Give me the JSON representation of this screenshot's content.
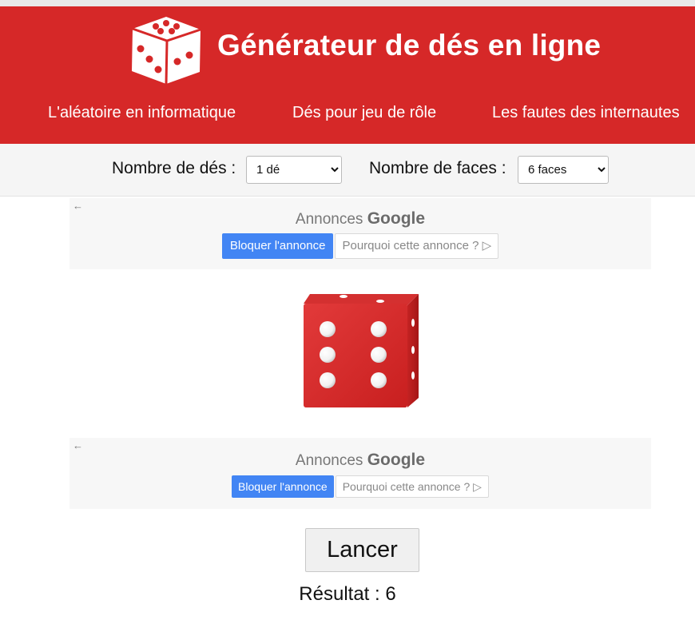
{
  "header": {
    "title": "Générateur de dés en ligne",
    "logo_icon": "dice-logo-icon",
    "background": "#d62828"
  },
  "nav": [
    {
      "label": "L'aléatoire en informatique"
    },
    {
      "label": "Dés pour jeu de rôle"
    },
    {
      "label": "Les fautes des internautes"
    }
  ],
  "options": {
    "dice_count_label": "Nombre de dés :",
    "dice_count_value": "1 dé",
    "faces_label": "Nombre de faces :",
    "faces_value": "6 faces"
  },
  "ads": [
    {
      "heading": "Annonces",
      "brand": "Google",
      "block_label": "Bloquer l'annonce",
      "why_label": "Pourquoi cette annonce ?"
    },
    {
      "heading": "Annonces",
      "brand": "Google",
      "block_label": "Bloquer l'annonce",
      "why_label": "Pourquoi cette annonce ?"
    }
  ],
  "die": {
    "face_value": 6,
    "color": "#d62828"
  },
  "launch_label": "Lancer",
  "result_text": "Résultat : 6"
}
